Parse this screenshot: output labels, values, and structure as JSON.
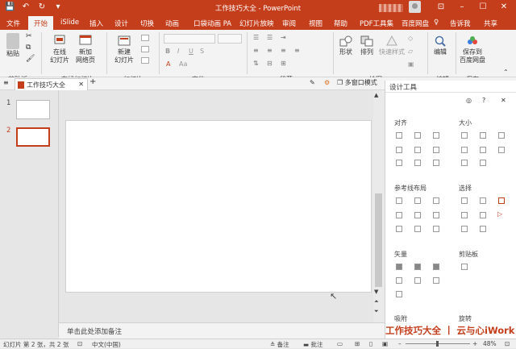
{
  "titlebar": {
    "title": "工作技巧大全  -  PowerPoint",
    "help_label": "告诉我",
    "share_label": "共享",
    "avatar_name": "user"
  },
  "tabs": [
    "文件",
    "开始",
    "iSlide",
    "插入",
    "设计",
    "切换",
    "动画",
    "口袋动画 PA",
    "幻灯片放映",
    "审阅",
    "视图",
    "帮助",
    "PDF工具集",
    "百度网盘"
  ],
  "ribbon": {
    "groups": {
      "clipboard": "剪贴板",
      "islide": "iSlide",
      "newslide": "在线幻灯片",
      "slides": "幻灯片",
      "font": "字体",
      "paragraph": "段落",
      "drawing": "绘图",
      "editing": "编辑",
      "save": "保存"
    },
    "buttons": {
      "paste": "粘贴",
      "online1": "在线",
      "online2": "幻灯片",
      "add1": "新加",
      "add2": "网络页",
      "new1": "新建",
      "new2": "幻灯片",
      "shape": "形状",
      "arrange": "排列",
      "quickstyle": "快速样式",
      "edit": "编辑",
      "save1": "保存到",
      "save2": "百度网盘"
    }
  },
  "doc_tab": "工作技巧大全",
  "view_label": "多窗口模式",
  "slides": [
    "1",
    "2"
  ],
  "notes_placeholder": "单击此处添加备注",
  "design_pane": {
    "title": "设计工具",
    "sections": {
      "align": "对齐",
      "size": "大小",
      "guides": "参考线布局",
      "select": "选择",
      "vector": "矢量",
      "clip": "剪贴板",
      "adsorb": "吸附",
      "rotate": "旋转"
    }
  },
  "status": {
    "slide_info": "幻灯片 第 2 张，共 2 张",
    "lang": "中文(中国)",
    "notes": "备注",
    "comments": "批注",
    "zoom": "48%"
  },
  "watermark": "工作技巧大全 丨 云与心iWork",
  "colors": {
    "accent": "#c43e1c"
  }
}
